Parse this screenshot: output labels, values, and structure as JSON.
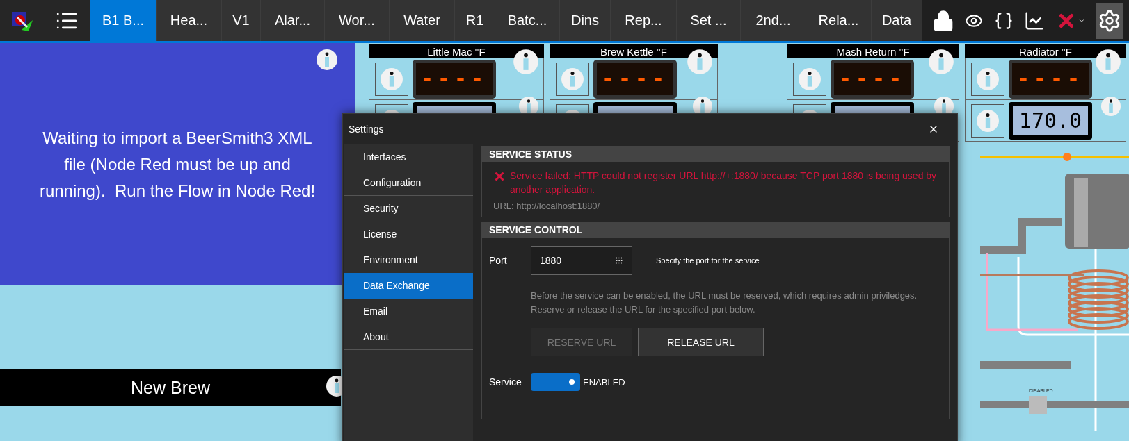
{
  "toolbar": {
    "tabs": [
      {
        "label": "B1 B...",
        "selected": true
      },
      {
        "label": "Hea...",
        "selected": false
      },
      {
        "label": "V1",
        "selected": false
      },
      {
        "label": "Alar...",
        "selected": false
      },
      {
        "label": "Wor...",
        "selected": false
      },
      {
        "label": "Water",
        "selected": false
      },
      {
        "label": "R1",
        "selected": false
      },
      {
        "label": "Batc...",
        "selected": false
      },
      {
        "label": "Dins",
        "selected": false
      },
      {
        "label": "Rep...",
        "selected": false
      },
      {
        "label": "Set ...",
        "selected": false
      },
      {
        "label": "2nd...",
        "selected": false
      },
      {
        "label": "Rela...",
        "selected": false
      },
      {
        "label": "Data",
        "selected": false
      }
    ]
  },
  "status_panel": {
    "message": "Waiting to import a BeerSmith3 XML file (Node Red must be up and running).  Run the Flow in Node Red!",
    "button": "New Brew"
  },
  "gauges": [
    {
      "title": "Little Mac °F",
      "led": "----"
    },
    {
      "title": "Brew Kettle °F",
      "led": "----"
    },
    {
      "title": "Mash Return °F",
      "led": "----"
    },
    {
      "title": "Radiator °F",
      "led": "----",
      "lcd": "170.0"
    }
  ],
  "diagram": {
    "meter_status": "DISABLED"
  },
  "dialog": {
    "title": "Settings",
    "nav": [
      {
        "label": "Interfaces",
        "selected": false,
        "divider_after": false
      },
      {
        "label": "Configuration",
        "selected": false,
        "divider_after": true
      },
      {
        "label": "Security",
        "selected": false,
        "divider_after": false
      },
      {
        "label": "License",
        "selected": false,
        "divider_after": false
      },
      {
        "label": "Environment",
        "selected": false,
        "divider_after": false
      },
      {
        "label": "Data Exchange",
        "selected": true,
        "divider_after": false
      },
      {
        "label": "Email",
        "selected": false,
        "divider_after": false
      },
      {
        "label": "About",
        "selected": false,
        "divider_after": true
      }
    ],
    "status": {
      "heading": "SERVICE STATUS",
      "error": "Service failed: HTTP could not register URL http://+:1880/ because TCP port 1880 is being used by another application.",
      "url": "URL: http://localhost:1880/"
    },
    "control": {
      "heading": "SERVICE CONTROL",
      "port_label": "Port",
      "port_value": "1880",
      "port_hint": "Specify the port for the service",
      "description": "Before the service can be enabled, the URL must be reserved, which requires admin priviledges. Reserve or release the URL for the specified port below.",
      "buttons": [
        {
          "label": "RESERVE URL",
          "disabled": true
        },
        {
          "label": "RELEASE URL",
          "disabled": false
        }
      ],
      "service_label": "Service",
      "service_on": true,
      "service_state": "ENABLED"
    }
  }
}
